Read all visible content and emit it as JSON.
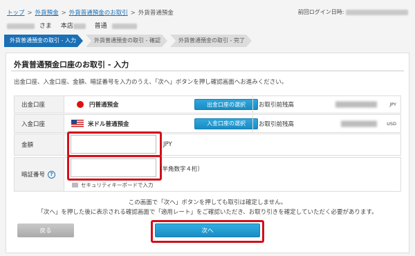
{
  "breadcrumb": [
    "トップ",
    "外貨預金",
    "外貨普通預金のお取引",
    "外貨普通預金"
  ],
  "last_login_label": "前回ログイン日時:",
  "user": {
    "honorific": "さま",
    "branch_label": "本店",
    "account_type": "普通"
  },
  "steps": [
    "外貨普通預金の取引 - 入力",
    "外貨普通預金の取引 - 確認",
    "外貨普通預金の取引 - 完了"
  ],
  "title": "外貨普通預金口座のお取引 - 入力",
  "instruction": "出金口座、入金口座、金額、暗証番号を入力のうえ、「次へ」ボタンを押し確認画面へお進みください。",
  "withdraw": {
    "label": "出金口座",
    "account": "円普通預金",
    "button": "出金口座の選択",
    "balance_label": "お取引前残高",
    "currency": "JPY"
  },
  "deposit": {
    "label": "入金口座",
    "account": "米ドル普通預金",
    "button": "入金口座の選択",
    "balance_label": "お取引前残高",
    "currency": "USD"
  },
  "amount": {
    "label": "金額",
    "unit": "JPY",
    "value": ""
  },
  "pin": {
    "label": "暗証番号",
    "hint": "（半角数字４桁）",
    "value": "",
    "keyboard_label": "セキュリティキーボードで入力"
  },
  "notes": [
    "この画面で「次へ」ボタンを押しても取引は確定しません。",
    "「次へ」を押した後に表示される確認画面で「適用レート」をご確認いただき、お取り引きを確定していただく必要があります。"
  ],
  "buttons": {
    "back": "戻る",
    "next": "次へ"
  },
  "colors": {
    "accent": "#1a6fb5",
    "button_blue": "#1a8cc4",
    "highlight_red": "#d1101a"
  }
}
